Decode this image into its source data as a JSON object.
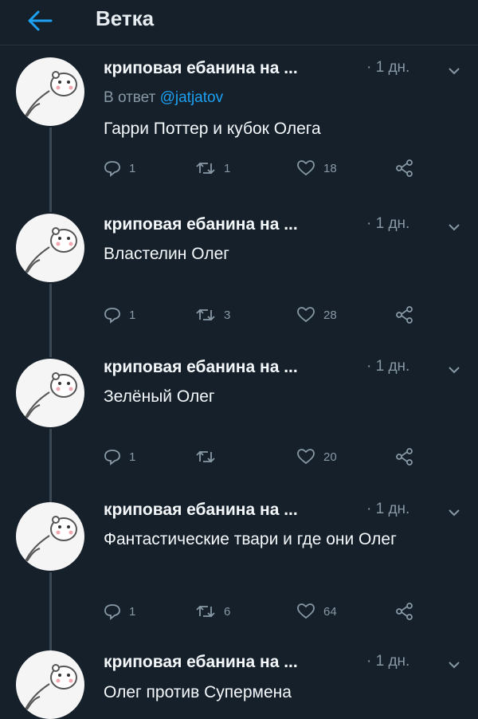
{
  "header": {
    "title": "Ветка"
  },
  "tweets": [
    {
      "author": "криповая ебанина на ...",
      "time": "· 1 дн.",
      "reply_prefix": "В ответ",
      "reply_handle": "@jatjatov",
      "text": "Гарри Поттер и кубок Олега",
      "replies": "1",
      "retweets": "1",
      "likes": "18"
    },
    {
      "author": "криповая ебанина на ...",
      "time": "· 1 дн.",
      "text": "Властелин Олег",
      "replies": "1",
      "retweets": "3",
      "likes": "28"
    },
    {
      "author": "криповая ебанина на ...",
      "time": "· 1 дн.",
      "text": "Зелёный Олег",
      "replies": "1",
      "retweets": "",
      "likes": "20"
    },
    {
      "author": "криповая ебанина на ...",
      "time": "· 1 дн.",
      "text": "Фантастические твари и где они Олег",
      "replies": "1",
      "retweets": "6",
      "likes": "64"
    },
    {
      "author": "криповая ебанина на ...",
      "time": "· 1 дн.",
      "text": "Олег против Супермена"
    }
  ]
}
